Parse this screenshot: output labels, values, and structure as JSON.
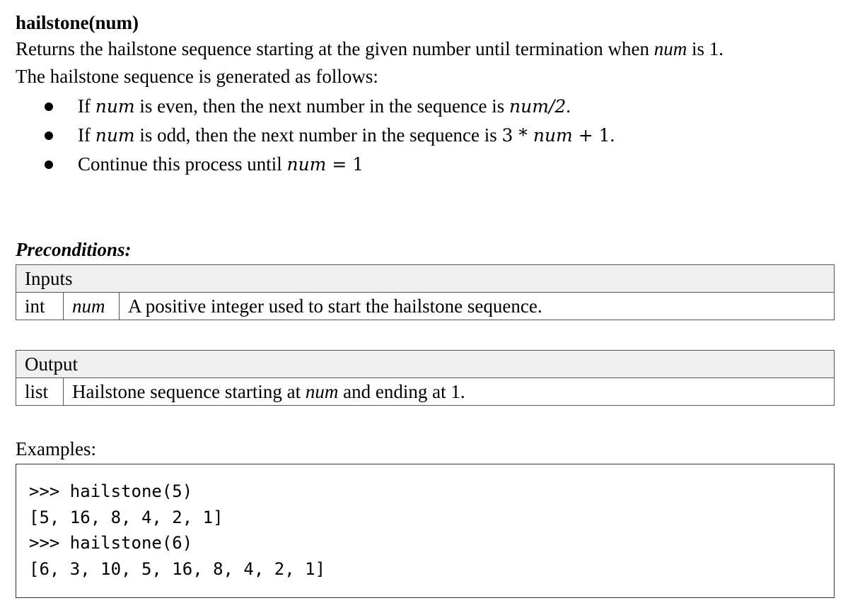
{
  "heading": {
    "func_name": "hailstone(num)"
  },
  "description": {
    "line1_pre": "Returns the hailstone sequence starting at the given number until termination when ",
    "line1_var": "num",
    "line1_post": " is 1.",
    "line2": "The hailstone sequence is generated as follows:"
  },
  "rules": [
    {
      "pre": "If ",
      "var": "num",
      "mid": " is even, then the next number in the sequence is ",
      "expr": "num/2",
      "post": "."
    },
    {
      "pre": "If ",
      "var": "num",
      "mid": " is odd, then the next number in the sequence is ",
      "expr_pre": "3 * ",
      "expr_var": "num",
      "expr_post": " + 1",
      "post": "."
    },
    {
      "pre": "Continue this process until ",
      "var": "num",
      "expr_post": " = 1"
    }
  ],
  "preconditions": {
    "title": "Preconditions:",
    "inputs_header": "Inputs",
    "inputs": [
      {
        "type": "int",
        "name": "num",
        "description": "A positive integer used to start the hailstone sequence."
      }
    ]
  },
  "output": {
    "header": "Output",
    "type": "list",
    "desc_pre": "Hailstone sequence starting at ",
    "desc_var": "num",
    "desc_post": " and ending at 1."
  },
  "examples": {
    "label": "Examples:",
    "lines": [
      ">>> hailstone(5)",
      "[5, 16, 8, 4, 2, 1]",
      ">>> hailstone(6)",
      "[6, 3, 10, 5, 16, 8, 4, 2, 1]"
    ]
  }
}
